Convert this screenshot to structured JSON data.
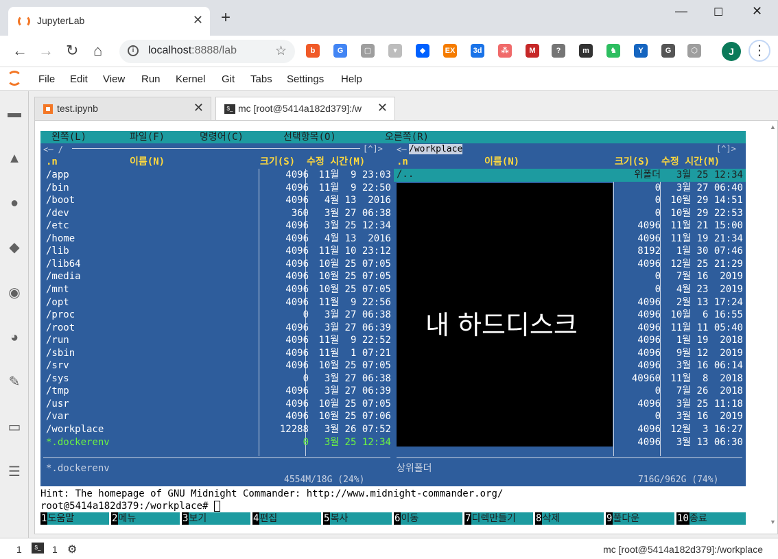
{
  "browser": {
    "tab_title": "JupyterLab",
    "new_tab_label": "+",
    "url_host": "localhost",
    "url_rest": ":8888/lab",
    "avatar_letter": "J",
    "extensions": [
      {
        "name": "bitwarden-icon",
        "glyph": "b",
        "color": "#f05a28"
      },
      {
        "name": "translate-icon",
        "glyph": "G",
        "color": "#4285f4"
      },
      {
        "name": "window-icon",
        "glyph": "▢",
        "color": "#9e9e9e"
      },
      {
        "name": "dropdown-ext-icon",
        "glyph": "▾",
        "color": "#bdbdbd"
      },
      {
        "name": "dropbox-icon",
        "glyph": "◆",
        "color": "#0061ff"
      },
      {
        "name": "ex-icon",
        "glyph": "EX",
        "color": "#f57c00"
      },
      {
        "name": "calendar-3d-icon",
        "glyph": "3d",
        "color": "#1a73e8"
      },
      {
        "name": "asana-icon",
        "glyph": "⁂",
        "color": "#f06a6a"
      },
      {
        "name": "mendeley-icon",
        "glyph": "M",
        "color": "#c62828"
      },
      {
        "name": "shield-ext-icon",
        "glyph": "?",
        "color": "#757575"
      },
      {
        "name": "m-ext-icon",
        "glyph": "m",
        "color": "#333333"
      },
      {
        "name": "evernote-icon",
        "glyph": "♞",
        "color": "#2dbe60"
      },
      {
        "name": "y-ext-icon",
        "glyph": "Y",
        "color": "#1565c0"
      },
      {
        "name": "grammar-icon",
        "glyph": "G",
        "color": "#555555"
      },
      {
        "name": "hex-ext-icon",
        "glyph": "⬡",
        "color": "#9e9e9e"
      }
    ]
  },
  "jupyter": {
    "menus": [
      "File",
      "Edit",
      "View",
      "Run",
      "Kernel",
      "Git",
      "Tabs",
      "Settings",
      "Help"
    ],
    "doc_tabs": [
      "test.ipynb",
      "mc [root@5414a182d379]:/w"
    ],
    "status_left_1": "1",
    "status_left_2": "1",
    "status_right": "mc [root@5414a182d379]:/workplace"
  },
  "mc": {
    "menubar": [
      "왼쪽(L)",
      "파일(F)",
      "명령어(C)",
      "선택항목(O)",
      "오른쪽(R)"
    ],
    "left_panel": {
      "path_line": "<─ / ",
      "corner": "[^]>",
      "headers": {
        "n": ".n",
        "name": "이름(N)",
        "size": "크기(S)",
        "mtime": "수정 시간(M)"
      },
      "rows": [
        {
          "name": "/app",
          "size": "4096",
          "date": "11월  9 23:03"
        },
        {
          "name": "/bin",
          "size": "4096",
          "date": "11월  9 22:50"
        },
        {
          "name": "/boot",
          "size": "4096",
          "date": " 4월 13  2016"
        },
        {
          "name": "/dev",
          "size": "360",
          "date": " 3월 27 06:38"
        },
        {
          "name": "/etc",
          "size": "4096",
          "date": " 3월 25 12:34"
        },
        {
          "name": "/home",
          "size": "4096",
          "date": " 4월 13  2016"
        },
        {
          "name": "/lib",
          "size": "4096",
          "date": "11월 10 23:12"
        },
        {
          "name": "/lib64",
          "size": "4096",
          "date": "10월 25 07:05"
        },
        {
          "name": "/media",
          "size": "4096",
          "date": "10월 25 07:05"
        },
        {
          "name": "/mnt",
          "size": "4096",
          "date": "10월 25 07:05"
        },
        {
          "name": "/opt",
          "size": "4096",
          "date": "11월  9 22:56"
        },
        {
          "name": "/proc",
          "size": "0",
          "date": " 3월 27 06:38"
        },
        {
          "name": "/root",
          "size": "4096",
          "date": " 3월 27 06:39"
        },
        {
          "name": "/run",
          "size": "4096",
          "date": "11월  9 22:52"
        },
        {
          "name": "/sbin",
          "size": "4096",
          "date": "11월  1 07:21"
        },
        {
          "name": "/srv",
          "size": "4096",
          "date": "10월 25 07:05"
        },
        {
          "name": "/sys",
          "size": "0",
          "date": " 3월 27 06:38"
        },
        {
          "name": "/tmp",
          "size": "4096",
          "date": " 3월 27 06:39"
        },
        {
          "name": "/usr",
          "size": "4096",
          "date": "10월 25 07:05"
        },
        {
          "name": "/var",
          "size": "4096",
          "date": "10월 25 07:06"
        },
        {
          "name": "/workplace",
          "size": "12288",
          "date": " 3월 26 07:52"
        },
        {
          "name": "*.dockerenv",
          "size": "0",
          "date": " 3월 25 12:34"
        }
      ],
      "status": "*.dockerenv",
      "usage": "4554M/18G (24%)"
    },
    "right_panel": {
      "path": " /workplace ",
      "corner": "[^]>",
      "headers": {
        "n": ".n",
        "name": "이름(N)",
        "size": "크기(S)",
        "mtime": "수정 시간(M)"
      },
      "updir": "/..",
      "rows": [
        {
          "size": "위폴더",
          "date": " 3월 25 12:34"
        },
        {
          "size": "0",
          "date": " 3월 27 06:40"
        },
        {
          "size": "0",
          "date": "10월 29 14:51"
        },
        {
          "size": "0",
          "date": "10월 29 22:53"
        },
        {
          "size": "4096",
          "date": "11월 21 15:00"
        },
        {
          "size": "4096",
          "date": "11월 19 21:34"
        },
        {
          "size": "8192",
          "date": " 1월 30 07:46"
        },
        {
          "size": "4096",
          "date": "12월 25 21:29"
        },
        {
          "size": "0",
          "date": " 7월 16  2019"
        },
        {
          "size": "0",
          "date": " 4월 23  2019"
        },
        {
          "size": "4096",
          "date": " 2월 13 17:24"
        },
        {
          "size": "4096",
          "date": "10월  6 16:55"
        },
        {
          "size": "4096",
          "date": "11월 11 05:40"
        },
        {
          "size": "4096",
          "date": " 1월 19  2018"
        },
        {
          "size": "4096",
          "date": " 9월 12  2019"
        },
        {
          "size": "4096",
          "date": " 3월 16 06:14"
        },
        {
          "size": "40960",
          "date": "11월  8  2018"
        },
        {
          "size": "0",
          "date": " 7월 26  2018"
        },
        {
          "size": "4096",
          "date": " 3월 25 11:18"
        },
        {
          "size": "0",
          "date": " 3월 16  2019"
        },
        {
          "size": "4096",
          "date": "12월  3 16:27"
        },
        {
          "size": "4096",
          "date": " 3월 13 06:30"
        }
      ],
      "overlay_text": "내 하드디스크",
      "status": "상위폴더",
      "usage": "716G/962G (74%)"
    },
    "hint": "Hint: The homepage of GNU Midnight Commander: http://www.midnight-commander.org/",
    "prompt": "root@5414a182d379:/workplace# ",
    "fkeys": [
      {
        "num": "1",
        "label": "도움말"
      },
      {
        "num": "2",
        "label": "메뉴"
      },
      {
        "num": "3",
        "label": "보기"
      },
      {
        "num": "4",
        "label": "편집"
      },
      {
        "num": "5",
        "label": "복사"
      },
      {
        "num": "6",
        "label": "이동"
      },
      {
        "num": "7",
        "label": "디렉만들기"
      },
      {
        "num": "8",
        "label": "삭제"
      },
      {
        "num": "9",
        "label": "풀다운"
      },
      {
        "num": "10",
        "label": "종료"
      }
    ]
  }
}
